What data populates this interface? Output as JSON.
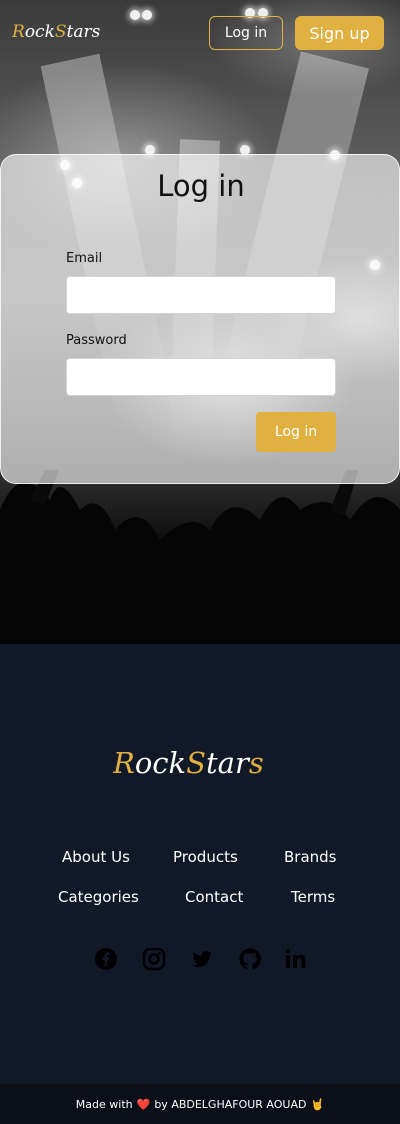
{
  "brand": {
    "name": "RockStars",
    "accent_color": "#e0b040",
    "dark_color": "#111827"
  },
  "nav": {
    "login_label": "Log in",
    "signup_label": "Sign up"
  },
  "login_form": {
    "title": "Log in",
    "email_label": "Email",
    "email_value": "",
    "password_label": "Password",
    "password_value": "",
    "submit_label": "Log in"
  },
  "footer": {
    "links": [
      "About Us",
      "Products",
      "Brands",
      "Categories",
      "Contact",
      "Terms"
    ],
    "social_icons": [
      "facebook-icon",
      "instagram-icon",
      "twitter-icon",
      "github-icon",
      "linkedin-icon"
    ],
    "made_with": "Made with",
    "heart": "❤️",
    "by": "by ABDELGHAFOUR AOUAD",
    "rock_emoji": "🤘"
  }
}
